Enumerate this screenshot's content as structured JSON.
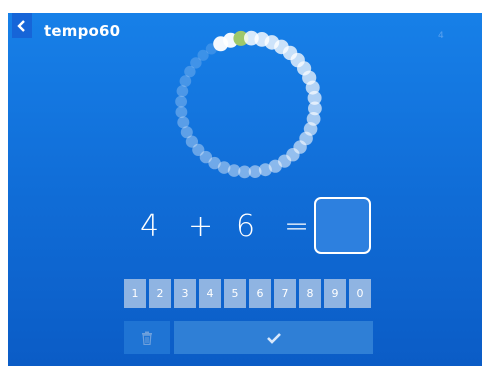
{
  "header": {
    "title": "tempo60",
    "count": "4",
    "back_icon": "chevron-left-icon"
  },
  "timer": {
    "dots_total": 40,
    "dots_elapsed": 2,
    "highlight_color": "#9ec86a"
  },
  "equation": {
    "operand_a": "4",
    "operator": "+",
    "operand_b": "6",
    "equals": "=",
    "answer": ""
  },
  "keypad": {
    "keys": [
      "1",
      "2",
      "3",
      "4",
      "5",
      "6",
      "7",
      "8",
      "9",
      "0"
    ]
  },
  "actions": {
    "delete_icon": "trash-icon",
    "confirm_icon": "check-icon"
  },
  "colors": {
    "background_top": "#1780e8",
    "background_bottom": "#0b5cc6",
    "key": "#8fb4e2"
  }
}
